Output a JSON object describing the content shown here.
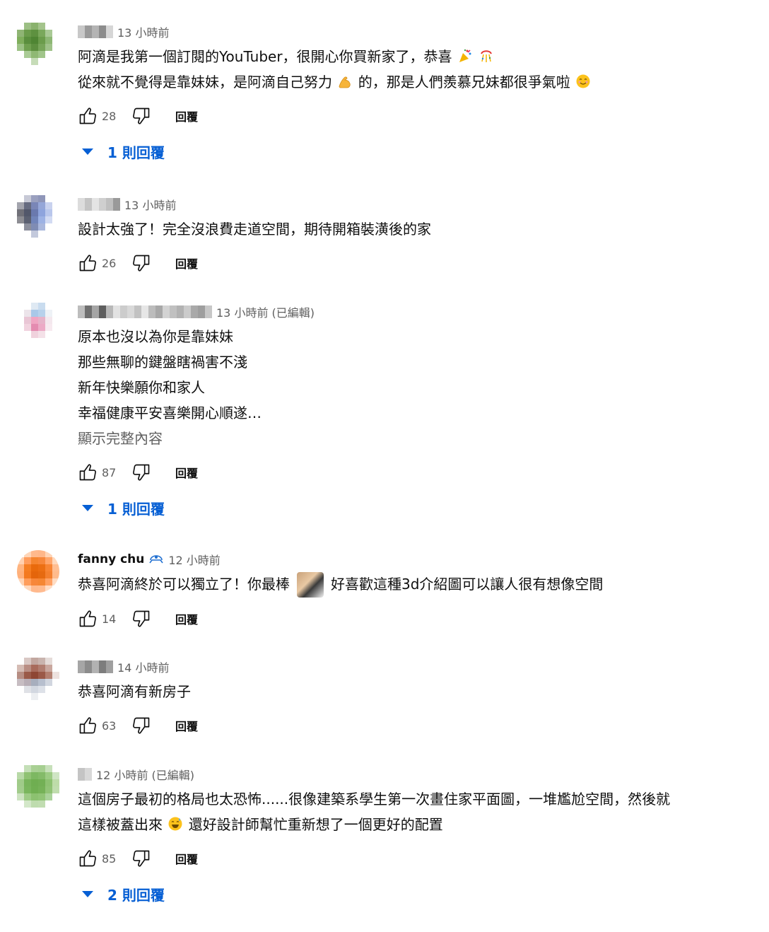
{
  "comments": [
    {
      "time": "13 小時前",
      "lines": [
        "阿滴是我第一個訂閱的YouTuber，很開心你買新家了，恭喜",
        "從來就不覺得是靠妹妹，是阿滴自己努力"
      ],
      "line2_tail": "的，那是人們羨慕兄妹都很爭氣啦",
      "likes": "28",
      "reply_label": "回覆",
      "replies_label": "1 則回覆",
      "avatar_colors": [
        "#ffffff",
        "#9cbf84",
        "#8ab26d",
        "#a4c48c",
        "#ffffff",
        "#ffffff",
        "#8fb474",
        "#6a9b4a",
        "#5e9140",
        "#7aa85b",
        "#a9c995",
        "#ffffff",
        "#7fae5c",
        "#5a8e3d",
        "#4f8533",
        "#6b9c4b",
        "#8db774",
        "#ffffff",
        "#9cc285",
        "#6fa04f",
        "#5d8f3f",
        "#77a559",
        "#9fc289",
        "#ffffff",
        "#ffffff",
        "#aacb96",
        "#8fb874",
        "#a1c58a",
        "#ffffff",
        "#ffffff",
        "#ffffff",
        "#ffffff",
        "#c6dcb8",
        "#ffffff",
        "#ffffff",
        "#ffffff"
      ],
      "name_mosaic": [
        "#c8c8c8",
        "#9a9a9a",
        "#b4b4b4",
        "#8c8c8c",
        "#d6d6d6"
      ]
    },
    {
      "time": "13 小時前",
      "lines": [
        "設計太強了！完全沒浪費走道空間，期待開箱裝潢後的家"
      ],
      "likes": "26",
      "reply_label": "回覆",
      "avatar_colors": [
        "#ffffff",
        "#c7c9d6",
        "#9aa0bf",
        "#8f96b9",
        "#ffffff",
        "#ffffff",
        "#a3a4ad",
        "#666b80",
        "#7a86b7",
        "#95a6d8",
        "#c9d2ef",
        "#ffffff",
        "#707078",
        "#52576a",
        "#6a79ae",
        "#8ea4dd",
        "#b9c7ec",
        "#ffffff",
        "#8d8d93",
        "#5b6071",
        "#7184b9",
        "#9db2e4",
        "#d2dbf3",
        "#ffffff",
        "#ffffff",
        "#8c8f9c",
        "#7f8cb4",
        "#aab8dd",
        "#ffffff",
        "#ffffff",
        "#ffffff",
        "#ffffff",
        "#c3c9dc",
        "#ffffff",
        "#ffffff",
        "#ffffff"
      ],
      "name_mosaic": [
        "#dcdcdc",
        "#c4c4c4",
        "#e4e4e4",
        "#cfcfcf",
        "#bfbfbf",
        "#9a9a9a"
      ]
    },
    {
      "time": "13 小時前 (已編輯)",
      "lines": [
        "原本也沒以為你是靠妹妹",
        "那些無聊的鍵盤瞎禍害不淺",
        "新年快樂願你和家人",
        "幸福健康平安喜樂開心順遂…"
      ],
      "show_more": "顯示完整內容",
      "likes": "87",
      "reply_label": "回覆",
      "replies_label": "1 則回覆",
      "avatar_colors": [
        "#ffffff",
        "#ffffff",
        "#dfe9f3",
        "#c9dcef",
        "#ffffff",
        "#ffffff",
        "#ffffff",
        "#ece4ea",
        "#a9c8e8",
        "#b7d1eb",
        "#eef2f6",
        "#ffffff",
        "#ffffff",
        "#e9c6d5",
        "#f0a5c2",
        "#e6b3c9",
        "#f4e8ee",
        "#ffffff",
        "#ffffff",
        "#f1d3df",
        "#e48bb0",
        "#ecaac6",
        "#f7eaf0",
        "#ffffff",
        "#ffffff",
        "#ffffff",
        "#f0d2dd",
        "#f4e1e8",
        "#ffffff",
        "#ffffff",
        "#ffffff",
        "#ffffff",
        "#ffffff",
        "#ffffff",
        "#ffffff",
        "#ffffff"
      ],
      "name_mosaic": [
        "#bdbdbd",
        "#6f6f6f",
        "#a5a5a5",
        "#5e5e5e",
        "#b8b8b8",
        "#e2e2e2",
        "#cccccc",
        "#d9d9d9",
        "#c2c2c2",
        "#e6e6e6",
        "#bcbcbc",
        "#a8a8a8",
        "#d3d3d3",
        "#c0c0c0",
        "#b2b2b2",
        "#cbcbcb",
        "#a9a9a9",
        "#9e9e9e",
        "#c7c7c7"
      ]
    },
    {
      "author": "fanny chu",
      "time": "12 小時前",
      "lines": [
        "恭喜阿滴終於可以獨立了！你最棒",
        "好喜歡這種3d介紹圖可以讓人很有想像空間"
      ],
      "likes": "14",
      "reply_label": "回覆",
      "avatar_colors": [
        "#ffffff",
        "#ffd6b8",
        "#ffb98c",
        "#ffb789",
        "#ffd4b5",
        "#ffffff",
        "#ffd1b0",
        "#ff9d5d",
        "#f5852f",
        "#f7873a",
        "#ffa56a",
        "#ffd8bc",
        "#ffb47f",
        "#f57e22",
        "#e96a0c",
        "#ec6f13",
        "#f88534",
        "#ffbe92",
        "#ffb07a",
        "#f47a1f",
        "#e4650b",
        "#e66a10",
        "#f4802e",
        "#ffbb8c",
        "#ffd3b3",
        "#ff9d5b",
        "#f7873a",
        "#f58734",
        "#ffa163",
        "#ffdcc3",
        "#ffffff",
        "#ffd8bc",
        "#ffb98d",
        "#ffbb90",
        "#ffdcc4",
        "#ffffff"
      ]
    },
    {
      "time": "14 小時前",
      "lines": [
        "恭喜阿滴有新房子"
      ],
      "likes": "63",
      "reply_label": "回覆",
      "avatar_colors": [
        "#ffffff",
        "#d9c8c4",
        "#c2a7a0",
        "#c9b4ae",
        "#e5dcd9",
        "#ffffff",
        "#d5bcb4",
        "#b98e83",
        "#a86b5c",
        "#b17e71",
        "#c9a79e",
        "#ffffff",
        "#b68d82",
        "#9a5a48",
        "#8e4634",
        "#9b5948",
        "#b47f70",
        "#ede2df",
        "#c7bdc2",
        "#b8aeb6",
        "#a7aebd",
        "#b7bfce",
        "#d1d6df",
        "#ffffff",
        "#ffffff",
        "#dfe1e6",
        "#d2d7e0",
        "#dde1e8",
        "#ffffff",
        "#ffffff",
        "#ffffff",
        "#ffffff",
        "#eceef1",
        "#ffffff",
        "#ffffff",
        "#ffffff"
      ],
      "name_mosaic": [
        "#a6a6a6",
        "#8c8c8c",
        "#b2b2b2",
        "#7d7d7d",
        "#9f9f9f"
      ]
    },
    {
      "time": "12 小時前 (已編輯)",
      "lines": [
        "這個房子最初的格局也太恐怖......很像建築系學生第一次畫住家平面圖，一堆尷尬空間，然後就",
        "這樣被蓋出來"
      ],
      "line2_tail": "還好設計師幫忙重新想了一個更好的配置",
      "likes": "85",
      "reply_label": "回覆",
      "replies_label": "2 則回覆",
      "avatar_colors": [
        "#ffffff",
        "#c4dfb7",
        "#a9d094",
        "#a6cf91",
        "#c7e0ba",
        "#ffffff",
        "#b8d9a7",
        "#8fc273",
        "#7db862",
        "#84bb69",
        "#9ccb83",
        "#cfe5c4",
        "#a0cb89",
        "#78b45b",
        "#6fae51",
        "#73b055",
        "#8dc171",
        "#bedca9",
        "#a2cc8c",
        "#7ab65d",
        "#70af52",
        "#76b258",
        "#91c376",
        "#c0ddae",
        "#cde3c1",
        "#9ecb86",
        "#8cc170",
        "#91c476",
        "#aad29a",
        "#ffffff",
        "#ffffff",
        "#d3e7c9",
        "#bedcae",
        "#c1ddb1",
        "#ffffff",
        "#ffffff"
      ],
      "name_mosaic": [
        "#c4c4c4",
        "#d8d8d8"
      ]
    }
  ]
}
